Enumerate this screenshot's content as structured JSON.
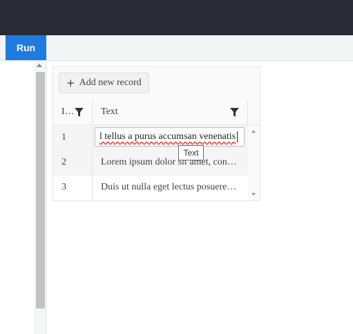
{
  "toolbar": {
    "run_label": "Run"
  },
  "grid": {
    "add_label": "Add new record",
    "columns": [
      {
        "label": "I…"
      },
      {
        "label": "Text"
      }
    ],
    "rows": [
      {
        "id": "1",
        "text": "l tellus a purus accumsan venenatis"
      },
      {
        "id": "2",
        "text": "Lorem ipsum dolor sit amet, con…"
      },
      {
        "id": "3",
        "text": "Duis ut nulla eget lectus posuere…"
      }
    ]
  },
  "tooltip": {
    "text": "Text"
  },
  "icons": {
    "add": "plus-icon",
    "filter": "filter-icon"
  }
}
